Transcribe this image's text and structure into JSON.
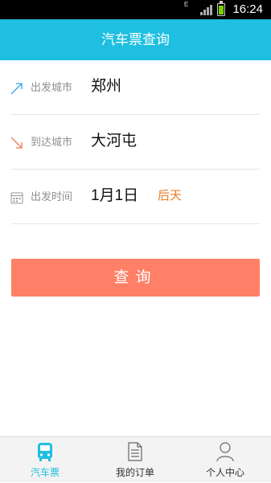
{
  "status_bar": {
    "time": "16:24",
    "network": "E",
    "battery_level": 0.8
  },
  "header": {
    "title": "汽车票查询"
  },
  "form": {
    "departure": {
      "label": "出发城市",
      "value": "郑州",
      "icon": "arrow-up-right-icon"
    },
    "arrival": {
      "label": "到达城市",
      "value": "大河屯",
      "icon": "arrow-down-right-icon"
    },
    "date": {
      "label": "出发时间",
      "value": "1月1日",
      "extra": "后天",
      "icon": "calendar-icon"
    }
  },
  "search_button": {
    "label": "查询"
  },
  "tabs": [
    {
      "label": "汽车票",
      "icon": "bus-icon",
      "active": true
    },
    {
      "label": "我的订单",
      "icon": "document-icon",
      "active": false
    },
    {
      "label": "个人中心",
      "icon": "person-icon",
      "active": false
    }
  ],
  "colors": {
    "primary": "#1ebfe0",
    "button": "#ff7f67",
    "accent_text": "#f07a20"
  }
}
